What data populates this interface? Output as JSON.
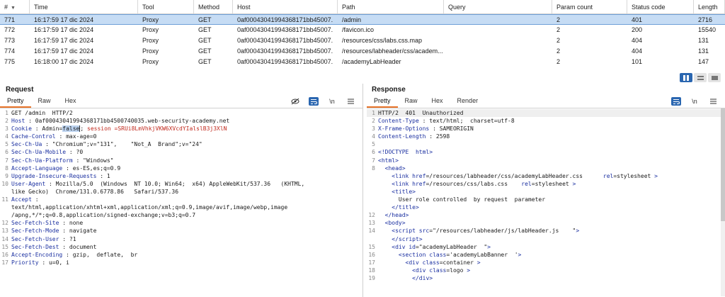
{
  "history": {
    "columns": [
      "#",
      "Time",
      "Tool",
      "Method",
      "Host",
      "Path",
      "Query",
      "Param count",
      "Status code",
      "Length"
    ],
    "rows": [
      {
        "num": "771",
        "time": "16:17:59 17 dic 2024",
        "tool": "Proxy",
        "method": "GET",
        "host": "0af00043041994368171bb45007.",
        "path": "/admin",
        "query": "",
        "params": "2",
        "status": "401",
        "length": "2716",
        "selected": true
      },
      {
        "num": "772",
        "time": "16:17:59 17 dic 2024",
        "tool": "Proxy",
        "method": "GET",
        "host": "0af00043041994368171bb45007.",
        "path": "/favicon.ico",
        "query": "",
        "params": "2",
        "status": "200",
        "length": "15540"
      },
      {
        "num": "773",
        "time": "16:17:59 17 dic 2024",
        "tool": "Proxy",
        "method": "GET",
        "host": "0af00043041994368171bb45007.",
        "path": "/resources/css/labs.css.map",
        "query": "",
        "params": "2",
        "status": "404",
        "length": "131"
      },
      {
        "num": "774",
        "time": "16:17:59 17 dic 2024",
        "tool": "Proxy",
        "method": "GET",
        "host": "0af00043041994368171bb45007.",
        "path": "/resources/labheader/css/academ...",
        "query": "",
        "params": "2",
        "status": "404",
        "length": "131"
      },
      {
        "num": "775",
        "time": "16:18:00 17 dic 2024",
        "tool": "Proxy",
        "method": "GET",
        "host": "0af00043041994368171bb45007.",
        "path": "/academyLabHeader",
        "query": "",
        "params": "2",
        "status": "101",
        "length": "147"
      }
    ]
  },
  "request": {
    "title": "Request",
    "tabs": [
      "Pretty",
      "Raw",
      "Hex"
    ],
    "newline_label": "\\n",
    "lines": [
      {
        "n": "1",
        "plain": "GET /admin  HTTP/2"
      },
      {
        "n": "2",
        "name": "Host",
        "value": " : 0af00043041994368171bb4500740035.web-security-academy.net"
      },
      {
        "n": "3",
        "name": "Cookie",
        "pre": " : Admin=",
        "hi": "false",
        "mid": "; ",
        "red": "session =SRUi8LmVhkjVKW6XVcdYIalslB3j3XlN"
      },
      {
        "n": "4",
        "name": "Cache-Control",
        "value": " : max-age=0"
      },
      {
        "n": "5",
        "name": "Sec-Ch-Ua",
        "value": " : \"Chromium\";v=\"131\",    \"Not_A  Brand\";v=\"24\""
      },
      {
        "n": "6",
        "name": "Sec-Ch-Ua-Mobile",
        "value": " : ?0"
      },
      {
        "n": "7",
        "name": "Sec-Ch-Ua-Platform",
        "value": " : \"Windows\""
      },
      {
        "n": "8",
        "name": "Accept-Language",
        "value": " : es-ES,es;q=0.9"
      },
      {
        "n": "9",
        "name": "Upgrade-Insecure-Requests",
        "value": " : 1"
      },
      {
        "n": "10",
        "name": "User-Agent",
        "value": " : Mozilla/5.0  (Windows  NT 10.0; Win64;  x64) AppleWebKit/537.36   (KHTML,\nlike Gecko)  Chrome/131.0.6778.86   Safari/537.36"
      },
      {
        "n": "11",
        "name": "Accept",
        "value": " :\ntext/html,application/xhtml+xml,application/xml;q=0.9,image/avif,image/webp,image\n/apng,*/*;q=0.8,application/signed-exchange;v=b3;q=0.7"
      },
      {
        "n": "12",
        "name": "Sec-Fetch-Site",
        "value": " : none"
      },
      {
        "n": "13",
        "name": "Sec-Fetch-Mode",
        "value": " : navigate"
      },
      {
        "n": "14",
        "name": "Sec-Fetch-User",
        "value": " : ?1"
      },
      {
        "n": "15",
        "name": "Sec-Fetch-Dest",
        "value": " : document"
      },
      {
        "n": "16",
        "name": "Accept-Encoding",
        "value": " : gzip,  deflate,  br"
      },
      {
        "n": "17",
        "name": "Priority",
        "value": " : u=0, i"
      }
    ]
  },
  "response": {
    "title": "Response",
    "tabs": [
      "Pretty",
      "Raw",
      "Hex",
      "Render"
    ],
    "newline_label": "\\n",
    "lines": [
      {
        "n": "1",
        "html": "HTTP/2  401  Unauthorized"
      },
      {
        "n": "2",
        "html": "<span class='hn'>Content-Type</span> : text/html;  charset=utf-8"
      },
      {
        "n": "3",
        "html": "<span class='hn'>X-Frame-Options</span> : SAMEORIGIN"
      },
      {
        "n": "4",
        "html": "<span class='hn'>Content-Length</span> : 2598"
      },
      {
        "n": "5",
        "html": ""
      },
      {
        "n": "6",
        "html": "<span class='tag'>&lt;!DOCTYPE  html&gt;</span>"
      },
      {
        "n": "7",
        "html": "<span class='tag'>&lt;html&gt;</span>"
      },
      {
        "n": "8",
        "html": "  <span class='tag'>&lt;head&gt;</span>"
      },
      {
        "n": "",
        "html": "    <span class='tag'>&lt;link </span><span class='attr'>href</span>=/resources/labheader/css/academyLabHeader.css      <span class='attr'>rel</span>=stylesheet <span class='tag'>&gt;</span>"
      },
      {
        "n": "",
        "html": "    <span class='tag'>&lt;link </span><span class='attr'>href</span>=/resources/css/labs.css    <span class='attr'>rel</span>=stylesheet <span class='tag'>&gt;</span>"
      },
      {
        "n": "",
        "html": "    <span class='tag'>&lt;title&gt;</span>"
      },
      {
        "n": "",
        "html": "      User role controlled  by request  parameter"
      },
      {
        "n": "",
        "html": "    <span class='tag'>&lt;/title&gt;</span>"
      },
      {
        "n": "12",
        "html": "  <span class='tag'>&lt;/head&gt;</span>"
      },
      {
        "n": "13",
        "html": "  <span class='tag'>&lt;body&gt;</span>"
      },
      {
        "n": "14",
        "html": "    <span class='tag'>&lt;script </span><span class='attr'>src</span>=\"/resources/labheader/js/labHeader.js    \"<span class='tag'>&gt;</span>"
      },
      {
        "n": "",
        "html": "    <span class='tag'>&lt;/script&gt;</span>"
      },
      {
        "n": "15",
        "html": "    <span class='tag'>&lt;div </span><span class='attr'>id</span>=\"academyLabHeader  \"<span class='tag'>&gt;</span>"
      },
      {
        "n": "16",
        "html": "      <span class='tag'>&lt;section </span><span class='attr'>class</span>='academyLabBanner  '<span class='tag'>&gt;</span>"
      },
      {
        "n": "17",
        "html": "        <span class='tag'>&lt;div </span><span class='attr'>class</span>=container <span class='tag'>&gt;</span>"
      },
      {
        "n": "18",
        "html": "          <span class='tag'>&lt;div </span><span class='attr'>class</span>=logo <span class='tag'>&gt;</span>"
      },
      {
        "n": "19",
        "html": "          <span class='tag'>&lt;/div&gt;</span>"
      }
    ]
  }
}
